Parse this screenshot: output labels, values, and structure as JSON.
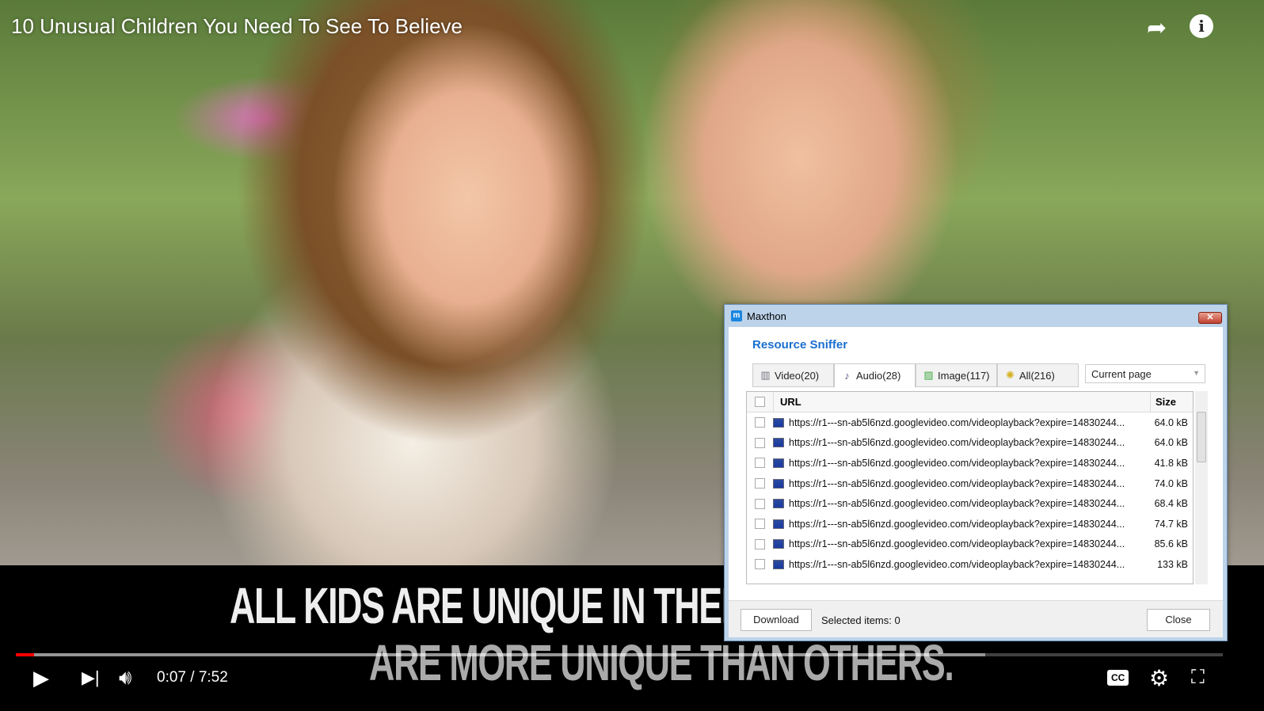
{
  "video": {
    "title": "10 Unusual Children You Need To See To Believe",
    "subtitle_line1": "ALL KIDS ARE UNIQUE IN THEIR OWN",
    "subtitle_line2": "ARE MORE UNIQUE THAN OTHERS.",
    "time": "0:07 / 7:52",
    "played_fraction": 0.015,
    "buffered_fraction": 0.803,
    "progress_color": "#ff0000",
    "icons": [
      "share-icon",
      "info-icon",
      "play-icon",
      "next-icon",
      "volume-icon",
      "cc-icon",
      "settings-icon",
      "exit-fullscreen-icon"
    ]
  },
  "dialog": {
    "window_title": "Maxthon",
    "heading": "Resource Sniffer",
    "accent": "#1a6fd0",
    "tabs": [
      {
        "label": "Video(20)",
        "icon": "film-icon"
      },
      {
        "label": "Audio(28)",
        "icon": "music-note-icon",
        "active": true
      },
      {
        "label": "Image(117)",
        "icon": "image-icon"
      },
      {
        "label": "All(216)",
        "icon": "star-icon"
      }
    ],
    "scope": "Current page",
    "columns": {
      "url": "URL",
      "size": "Size"
    },
    "rows": [
      {
        "url": "https://r1---sn-ab5l6nzd.googlevideo.com/videoplayback?expire=14830244...",
        "size": "64.0 kB"
      },
      {
        "url": "https://r1---sn-ab5l6nzd.googlevideo.com/videoplayback?expire=14830244...",
        "size": "64.0 kB"
      },
      {
        "url": "https://r1---sn-ab5l6nzd.googlevideo.com/videoplayback?expire=14830244...",
        "size": "41.8 kB"
      },
      {
        "url": "https://r1---sn-ab5l6nzd.googlevideo.com/videoplayback?expire=14830244...",
        "size": "74.0 kB"
      },
      {
        "url": "https://r1---sn-ab5l6nzd.googlevideo.com/videoplayback?expire=14830244...",
        "size": "68.4 kB"
      },
      {
        "url": "https://r1---sn-ab5l6nzd.googlevideo.com/videoplayback?expire=14830244...",
        "size": "74.7 kB"
      },
      {
        "url": "https://r1---sn-ab5l6nzd.googlevideo.com/videoplayback?expire=14830244...",
        "size": "85.6 kB"
      },
      {
        "url": "https://r1---sn-ab5l6nzd.googlevideo.com/videoplayback?expire=14830244...",
        "size": "133 kB"
      }
    ],
    "download": "Download",
    "selected": "Selected items: 0",
    "close": "Close"
  }
}
